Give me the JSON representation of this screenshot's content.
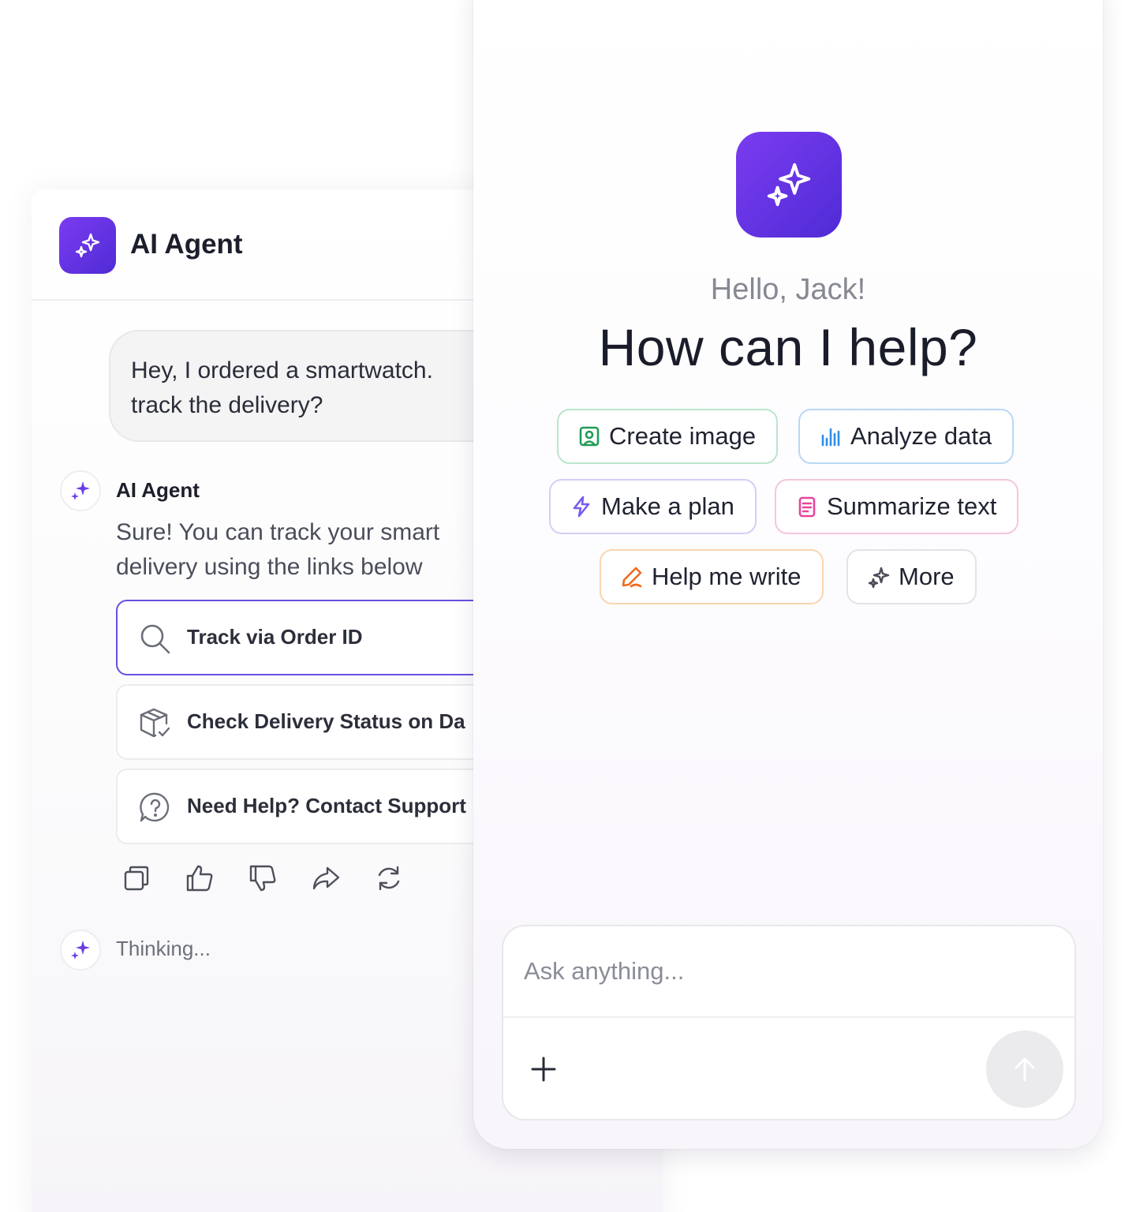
{
  "agent": {
    "title": "AI Agent"
  },
  "chat": {
    "user_message_lines": [
      "Hey, I ordered a smartwatch.",
      "track the delivery?"
    ],
    "reply": {
      "author": "AI Agent",
      "text_lines": [
        "Sure! You can track your smart",
        "delivery using the links below"
      ]
    },
    "links": [
      {
        "label": "Track via Order ID",
        "icon": "search-icon"
      },
      {
        "label": "Check Delivery Status on Da",
        "icon": "package-check-icon"
      },
      {
        "label": "Need Help? Contact Support",
        "icon": "help-chat-icon"
      }
    ],
    "feedback_icons": [
      "copy-icon",
      "thumbs-up-icon",
      "thumbs-down-icon",
      "share-icon",
      "regenerate-icon"
    ],
    "thinking_text": "Thinking..."
  },
  "assistant_home": {
    "greeting": "Hello, Jack!",
    "headline": "How can I help?",
    "suggestions": [
      {
        "label": "Create image",
        "icon": "image-icon",
        "color": "#1f9d55"
      },
      {
        "label": "Analyze data",
        "icon": "bar-chart-icon",
        "color": "#2f8ee8"
      },
      {
        "label": "Make a plan",
        "icon": "lightning-icon",
        "color": "#7b5cf0"
      },
      {
        "label": "Summarize text",
        "icon": "document-icon",
        "color": "#e8459a"
      },
      {
        "label": "Help me write",
        "icon": "pen-icon",
        "color": "#ef6b1f"
      },
      {
        "label": "More",
        "icon": "sparkles-icon",
        "color": "#4a4d58"
      }
    ],
    "composer": {
      "placeholder": "Ask anything...",
      "value": ""
    }
  },
  "colors": {
    "brand_gradient_start": "#7b3cf0",
    "brand_gradient_end": "#4f2bd6",
    "active_border": "#6a4fe0"
  }
}
